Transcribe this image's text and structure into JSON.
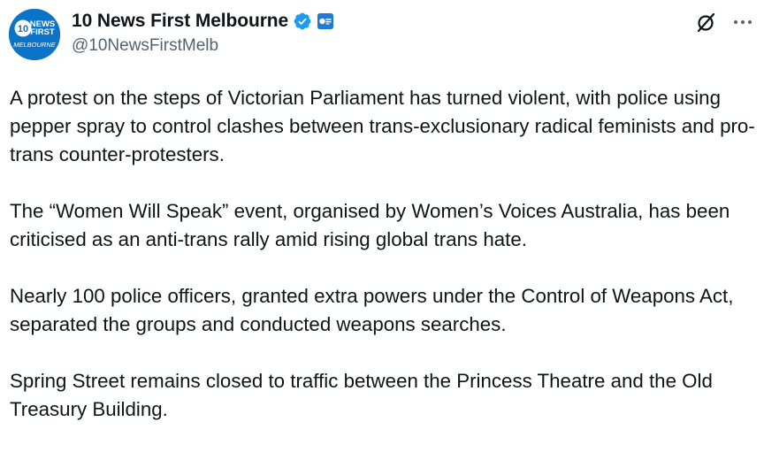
{
  "author": {
    "display_name": "10 News First Melbourne",
    "handle": "@10NewsFirstMelb",
    "avatar_text": {
      "number": "10",
      "line1": "NEWS",
      "line2": "FIRST",
      "line3": "MELBOURNE"
    },
    "verified": true,
    "affiliate_badge_icon": "affiliate-badge-icon"
  },
  "actions": {
    "grok_icon": "grok-icon",
    "more_icon": "more-options-icon"
  },
  "tweet": {
    "paragraphs": [
      "A protest on the steps of Victorian Parliament has turned violent, with police using pepper spray to control clashes between trans-exclusionary radical feminists and pro-trans counter-protesters.",
      "The “Women Will Speak” event, organised by Women’s Voices Australia, has been criticised as an anti-trans rally amid rising global trans hate.",
      "Nearly 100 police officers, granted extra powers under the Control of Weapons Act, separated the groups and conducted weapons searches.",
      "Spring Street remains closed to traffic between the Princess Theatre and the Old Treasury Building."
    ]
  },
  "colors": {
    "text": "#0f1419",
    "secondary_text": "#536471",
    "verified_blue": "#1d9bf0",
    "avatar_blue": "#0b74c9"
  }
}
